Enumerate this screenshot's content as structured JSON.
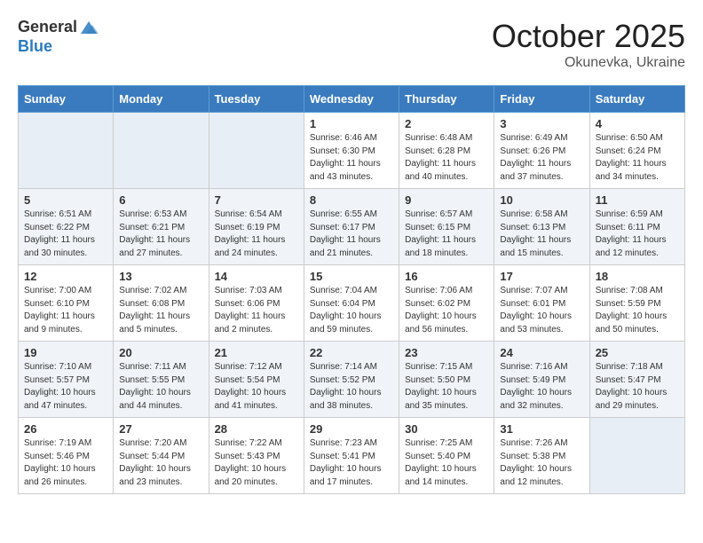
{
  "logo": {
    "general": "General",
    "blue": "Blue"
  },
  "header": {
    "month": "October 2025",
    "location": "Okunevka, Ukraine"
  },
  "days_of_week": [
    "Sunday",
    "Monday",
    "Tuesday",
    "Wednesday",
    "Thursday",
    "Friday",
    "Saturday"
  ],
  "weeks": [
    [
      {
        "day": "",
        "info": ""
      },
      {
        "day": "",
        "info": ""
      },
      {
        "day": "",
        "info": ""
      },
      {
        "day": "1",
        "info": "Sunrise: 6:46 AM\nSunset: 6:30 PM\nDaylight: 11 hours\nand 43 minutes."
      },
      {
        "day": "2",
        "info": "Sunrise: 6:48 AM\nSunset: 6:28 PM\nDaylight: 11 hours\nand 40 minutes."
      },
      {
        "day": "3",
        "info": "Sunrise: 6:49 AM\nSunset: 6:26 PM\nDaylight: 11 hours\nand 37 minutes."
      },
      {
        "day": "4",
        "info": "Sunrise: 6:50 AM\nSunset: 6:24 PM\nDaylight: 11 hours\nand 34 minutes."
      }
    ],
    [
      {
        "day": "5",
        "info": "Sunrise: 6:51 AM\nSunset: 6:22 PM\nDaylight: 11 hours\nand 30 minutes."
      },
      {
        "day": "6",
        "info": "Sunrise: 6:53 AM\nSunset: 6:21 PM\nDaylight: 11 hours\nand 27 minutes."
      },
      {
        "day": "7",
        "info": "Sunrise: 6:54 AM\nSunset: 6:19 PM\nDaylight: 11 hours\nand 24 minutes."
      },
      {
        "day": "8",
        "info": "Sunrise: 6:55 AM\nSunset: 6:17 PM\nDaylight: 11 hours\nand 21 minutes."
      },
      {
        "day": "9",
        "info": "Sunrise: 6:57 AM\nSunset: 6:15 PM\nDaylight: 11 hours\nand 18 minutes."
      },
      {
        "day": "10",
        "info": "Sunrise: 6:58 AM\nSunset: 6:13 PM\nDaylight: 11 hours\nand 15 minutes."
      },
      {
        "day": "11",
        "info": "Sunrise: 6:59 AM\nSunset: 6:11 PM\nDaylight: 11 hours\nand 12 minutes."
      }
    ],
    [
      {
        "day": "12",
        "info": "Sunrise: 7:00 AM\nSunset: 6:10 PM\nDaylight: 11 hours\nand 9 minutes."
      },
      {
        "day": "13",
        "info": "Sunrise: 7:02 AM\nSunset: 6:08 PM\nDaylight: 11 hours\nand 5 minutes."
      },
      {
        "day": "14",
        "info": "Sunrise: 7:03 AM\nSunset: 6:06 PM\nDaylight: 11 hours\nand 2 minutes."
      },
      {
        "day": "15",
        "info": "Sunrise: 7:04 AM\nSunset: 6:04 PM\nDaylight: 10 hours\nand 59 minutes."
      },
      {
        "day": "16",
        "info": "Sunrise: 7:06 AM\nSunset: 6:02 PM\nDaylight: 10 hours\nand 56 minutes."
      },
      {
        "day": "17",
        "info": "Sunrise: 7:07 AM\nSunset: 6:01 PM\nDaylight: 10 hours\nand 53 minutes."
      },
      {
        "day": "18",
        "info": "Sunrise: 7:08 AM\nSunset: 5:59 PM\nDaylight: 10 hours\nand 50 minutes."
      }
    ],
    [
      {
        "day": "19",
        "info": "Sunrise: 7:10 AM\nSunset: 5:57 PM\nDaylight: 10 hours\nand 47 minutes."
      },
      {
        "day": "20",
        "info": "Sunrise: 7:11 AM\nSunset: 5:55 PM\nDaylight: 10 hours\nand 44 minutes."
      },
      {
        "day": "21",
        "info": "Sunrise: 7:12 AM\nSunset: 5:54 PM\nDaylight: 10 hours\nand 41 minutes."
      },
      {
        "day": "22",
        "info": "Sunrise: 7:14 AM\nSunset: 5:52 PM\nDaylight: 10 hours\nand 38 minutes."
      },
      {
        "day": "23",
        "info": "Sunrise: 7:15 AM\nSunset: 5:50 PM\nDaylight: 10 hours\nand 35 minutes."
      },
      {
        "day": "24",
        "info": "Sunrise: 7:16 AM\nSunset: 5:49 PM\nDaylight: 10 hours\nand 32 minutes."
      },
      {
        "day": "25",
        "info": "Sunrise: 7:18 AM\nSunset: 5:47 PM\nDaylight: 10 hours\nand 29 minutes."
      }
    ],
    [
      {
        "day": "26",
        "info": "Sunrise: 7:19 AM\nSunset: 5:46 PM\nDaylight: 10 hours\nand 26 minutes."
      },
      {
        "day": "27",
        "info": "Sunrise: 7:20 AM\nSunset: 5:44 PM\nDaylight: 10 hours\nand 23 minutes."
      },
      {
        "day": "28",
        "info": "Sunrise: 7:22 AM\nSunset: 5:43 PM\nDaylight: 10 hours\nand 20 minutes."
      },
      {
        "day": "29",
        "info": "Sunrise: 7:23 AM\nSunset: 5:41 PM\nDaylight: 10 hours\nand 17 minutes."
      },
      {
        "day": "30",
        "info": "Sunrise: 7:25 AM\nSunset: 5:40 PM\nDaylight: 10 hours\nand 14 minutes."
      },
      {
        "day": "31",
        "info": "Sunrise: 7:26 AM\nSunset: 5:38 PM\nDaylight: 10 hours\nand 12 minutes."
      },
      {
        "day": "",
        "info": ""
      }
    ]
  ]
}
